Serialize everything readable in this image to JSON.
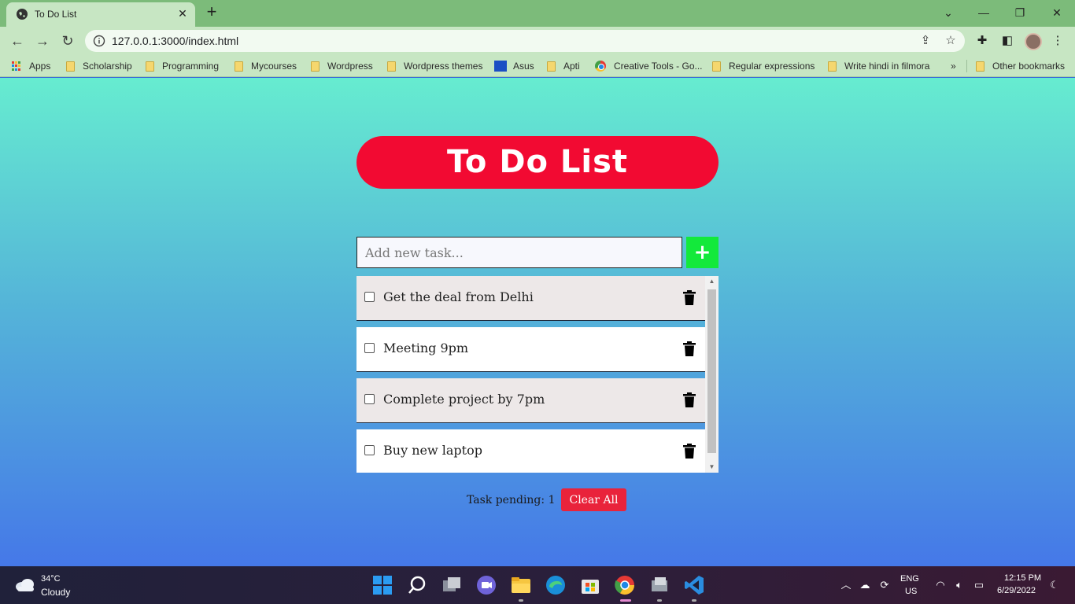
{
  "browser": {
    "tab_title": "To Do List",
    "tab_close": "✕",
    "new_tab": "+",
    "url": "127.0.0.1:3000/index.html",
    "bookmarks": [
      {
        "label": "Apps",
        "icon": "apps-grid-icon"
      },
      {
        "label": "Scholarship",
        "icon": "folder-icon"
      },
      {
        "label": "Programming",
        "icon": "folder-icon"
      },
      {
        "label": "Mycourses",
        "icon": "folder-icon"
      },
      {
        "label": "Wordpress",
        "icon": "folder-icon"
      },
      {
        "label": "Wordpress themes",
        "icon": "folder-icon"
      },
      {
        "label": "Asus",
        "icon": "asus-icon"
      },
      {
        "label": "Apti",
        "icon": "folder-icon"
      },
      {
        "label": "Creative Tools - Go...",
        "icon": "chrome-icon"
      },
      {
        "label": "Regular expressions",
        "icon": "folder-icon"
      },
      {
        "label": "Write hindi in filmora",
        "icon": "folder-icon"
      }
    ],
    "more_bookmarks": "»",
    "other_bookmarks": "Other bookmarks"
  },
  "app": {
    "title": "To Do List",
    "input_placeholder": "Add new task...",
    "add_label": "+",
    "tasks": [
      {
        "text": "Get the deal from Delhi",
        "bg": "#ede8e8"
      },
      {
        "text": "Meeting 9pm",
        "bg": "#ffffff"
      },
      {
        "text": "Complete project by 7pm",
        "bg": "#ede8e8"
      },
      {
        "text": "Buy new laptop",
        "bg": "#ffffff"
      }
    ],
    "pending_text": "Task pending: 1",
    "clear_label": "Clear All"
  },
  "colors": {
    "title_bg": "#f20a32",
    "add_btn": "#13e93b",
    "clear_btn": "#e9233b"
  },
  "taskbar": {
    "temperature": "34°C",
    "weather": "Cloudy",
    "language": "ENG",
    "region": "US",
    "time": "12:15 PM",
    "date": "6/29/2022"
  }
}
